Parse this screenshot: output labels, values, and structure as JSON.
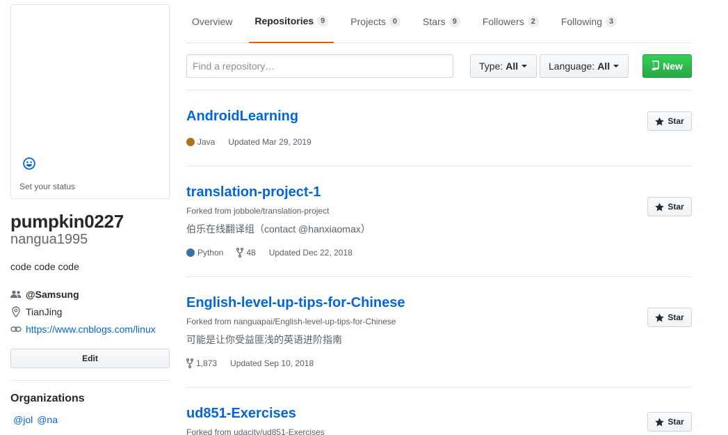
{
  "profile": {
    "status_text": "Set your status",
    "username": "pumpkin0227",
    "nickname": "nangua1995",
    "bio": "code code code",
    "organization": "@Samsung",
    "location": "TianJing",
    "website": "https://www.cnblogs.com/linux",
    "edit_label": "Edit",
    "orgs_title": "Organizations",
    "orgs": [
      "@jol",
      "@na"
    ]
  },
  "tabs": [
    {
      "label": "Overview",
      "count": null
    },
    {
      "label": "Repositories",
      "count": "9"
    },
    {
      "label": "Projects",
      "count": "0"
    },
    {
      "label": "Stars",
      "count": "9"
    },
    {
      "label": "Followers",
      "count": "2"
    },
    {
      "label": "Following",
      "count": "3"
    }
  ],
  "filters": {
    "search_placeholder": "Find a repository…",
    "type_label": "Type:",
    "type_value": "All",
    "language_label": "Language:",
    "language_value": "All",
    "new_label": "New"
  },
  "repos": [
    {
      "name": "AndroidLearning",
      "forked_from": "",
      "description": "",
      "language": "Java",
      "language_color": "#b07219",
      "forks": "",
      "updated": "Updated Mar 29, 2019",
      "star_label": "Star"
    },
    {
      "name": "translation-project-1",
      "forked_from": "Forked from jobbole/translation-project",
      "description": "伯乐在线翻译组（contact @hanxiaomax）",
      "language": "Python",
      "language_color": "#3572A5",
      "forks": "48",
      "updated": "Updated Dec 22, 2018",
      "star_label": "Star"
    },
    {
      "name": "English-level-up-tips-for-Chinese",
      "forked_from": "Forked from nanguapai/English-level-up-tips-for-Chinese",
      "description": "可能是让你受益匪浅的英语进阶指南",
      "language": "",
      "language_color": "",
      "forks": "1,873",
      "updated": "Updated Sep 10, 2018",
      "star_label": "Star"
    },
    {
      "name": "ud851-Exercises",
      "forked_from": "Forked from udacity/ud851-Exercises",
      "description": "",
      "language": "",
      "language_color": "",
      "forks": "",
      "updated": "",
      "star_label": "Star"
    }
  ]
}
